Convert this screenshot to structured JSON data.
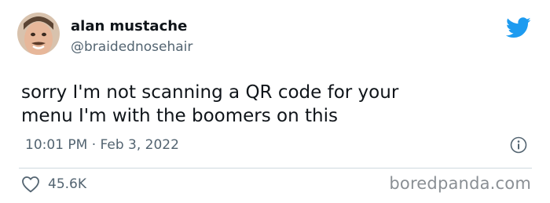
{
  "author": {
    "name": "alan mustache",
    "handle": "@braidednosehair"
  },
  "tweet": {
    "lines": [
      "sorry I'm not scanning a QR code for your",
      "menu I'm with the boomers on this"
    ],
    "timestamp": "10:01 PM · Feb 3, 2022"
  },
  "engagement": {
    "likes": "45.6K"
  },
  "watermark": "boredpanda.com",
  "icons": {
    "brand": "twitter-bird-icon",
    "info": "info-icon",
    "like": "heart-outline-icon"
  },
  "colors": {
    "text": "#0f1419",
    "secondary": "#536471",
    "twitter_blue": "#1d9bf0",
    "divider": "#cfd9de",
    "watermark": "#8a8f94"
  }
}
